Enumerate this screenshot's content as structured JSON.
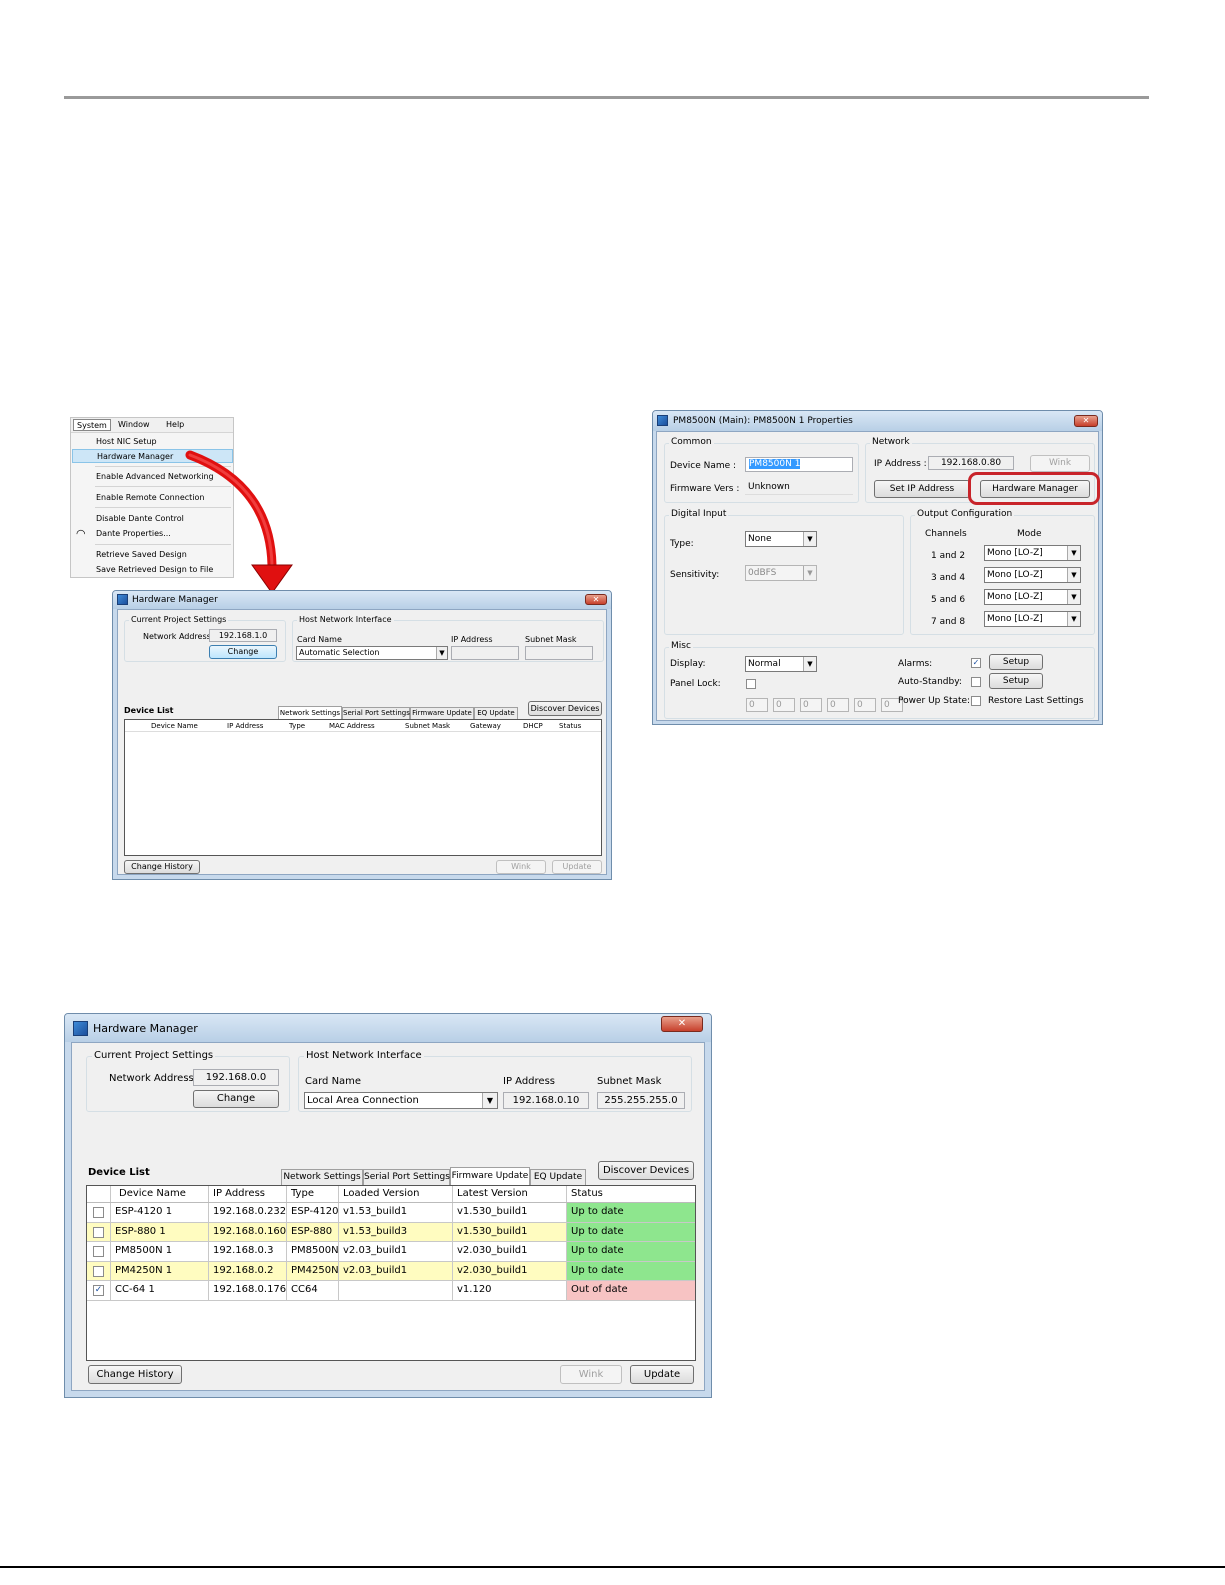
{
  "menu": {
    "bar": [
      "System",
      "Window",
      "Help"
    ],
    "items": [
      "Host NIC Setup",
      "Hardware Manager",
      "Enable Advanced Networking",
      "Enable Remote Connection",
      "Disable Dante Control",
      "Dante Properties...",
      "Retrieve Saved Design",
      "Save Retrieved Design to File"
    ]
  },
  "hm_small": {
    "title": "Hardware Manager",
    "close": "✕",
    "current_project": "Current Project Settings",
    "network_address_label": "Network Address:",
    "network_address": "192.168.1.0",
    "change": "Change",
    "host_nic": "Host Network Interface",
    "card_name_label": "Card Name",
    "card_name": "Automatic Selection",
    "ip_label": "IP Address",
    "subnet_label": "Subnet Mask",
    "device_list": "Device List",
    "tabs": [
      "Network Settings",
      "Serial Port Settings",
      "Firmware Update",
      "EQ Update"
    ],
    "discover": "Discover Devices",
    "columns": [
      "Device Name",
      "IP Address",
      "Type",
      "MAC Address",
      "Subnet Mask",
      "Gateway",
      "DHCP",
      "Status"
    ],
    "change_history": "Change History",
    "wink": "Wink",
    "update": "Update"
  },
  "props": {
    "title": "PM8500N (Main): PM8500N 1 Properties",
    "close": "✕",
    "common": "Common",
    "device_name_label": "Device Name :",
    "device_name": "PM8500N 1",
    "firmware_label": "Firmware Vers :",
    "firmware": "Unknown",
    "network": "Network",
    "ip_label": "IP Address :",
    "ip": "192.168.0.80",
    "wink": "Wink",
    "set_ip": "Set IP Address",
    "hardware_manager": "Hardware Manager",
    "digital_input": "Digital Input",
    "type_label": "Type:",
    "type": "None",
    "sensitivity_label": "Sensitivity:",
    "sensitivity": "0dBFS",
    "output_config": "Output Configuration",
    "channels_hdr": "Channels",
    "mode_hdr": "Mode",
    "outputs": [
      {
        "channels": "1 and 2",
        "mode": "Mono [LO-Z]"
      },
      {
        "channels": "3 and 4",
        "mode": "Mono [LO-Z]"
      },
      {
        "channels": "5 and 6",
        "mode": "Mono [LO-Z]"
      },
      {
        "channels": "7 and 8",
        "mode": "Mono [LO-Z]"
      }
    ],
    "misc": "Misc",
    "display_label": "Display:",
    "display": "Normal",
    "panel_lock_label": "Panel Lock:",
    "spin_values": [
      "0",
      "0",
      "0",
      "0",
      "0",
      "0"
    ],
    "alarms_label": "Alarms:",
    "auto_standby_label": "Auto-Standby:",
    "power_up_label": "Power Up State:",
    "restore_label": "Restore Last Settings",
    "setup": "Setup",
    "check": "✓"
  },
  "hm_big": {
    "title": "Hardware Manager",
    "close": "✕",
    "current_project": "Current Project Settings",
    "network_address_label": "Network Address:",
    "network_address": "192.168.0.0",
    "change": "Change",
    "host_nic": "Host Network Interface",
    "card_name_label": "Card Name",
    "card_name": "Local Area Connection",
    "ip_label": "IP Address",
    "ip": "192.168.0.10",
    "subnet_label": "Subnet Mask",
    "subnet": "255.255.255.0",
    "device_list": "Device List",
    "tabs": [
      "Network Settings",
      "Serial Port Settings",
      "Firmware Update",
      "EQ Update"
    ],
    "discover": "Discover Devices",
    "columns": [
      "Device Name",
      "IP Address",
      "Type",
      "Loaded Version",
      "Latest Version",
      "Status"
    ],
    "rows": [
      {
        "checked": false,
        "name": "ESP-4120 1",
        "ip": "192.168.0.232",
        "type": "ESP-4120",
        "loaded": "v1.53_build1",
        "latest": "v1.530_build1",
        "status": "Up to date",
        "highlight": false,
        "status_color": "#8ee68e"
      },
      {
        "checked": false,
        "name": "ESP-880 1",
        "ip": "192.168.0.160",
        "type": "ESP-880",
        "loaded": "v1.53_build3",
        "latest": "v1.530_build1",
        "status": "Up to date",
        "highlight": true,
        "status_color": "#8ee68e"
      },
      {
        "checked": false,
        "name": "PM8500N 1",
        "ip": "192.168.0.3",
        "type": "PM8500N",
        "loaded": "v2.03_build1",
        "latest": "v2.030_build1",
        "status": "Up to date",
        "highlight": false,
        "status_color": "#8ee68e"
      },
      {
        "checked": false,
        "name": "PM4250N 1",
        "ip": "192.168.0.2",
        "type": "PM4250N",
        "loaded": "v2.03_build1",
        "latest": "v2.030_build1",
        "status": "Up to date",
        "highlight": true,
        "status_color": "#8ee68e"
      },
      {
        "checked": true,
        "name": "CC-64 1",
        "ip": "192.168.0.176",
        "type": "CC64",
        "loaded": "",
        "latest": "v1.120",
        "status": "Out of date",
        "highlight": false,
        "status_color": "#f7c3c3"
      }
    ],
    "change_history": "Change History",
    "wink": "Wink",
    "update": "Update"
  },
  "colors": {
    "highlight_row": "#fffcc0",
    "callout": "#c8242a",
    "arrow": "#e01010"
  }
}
